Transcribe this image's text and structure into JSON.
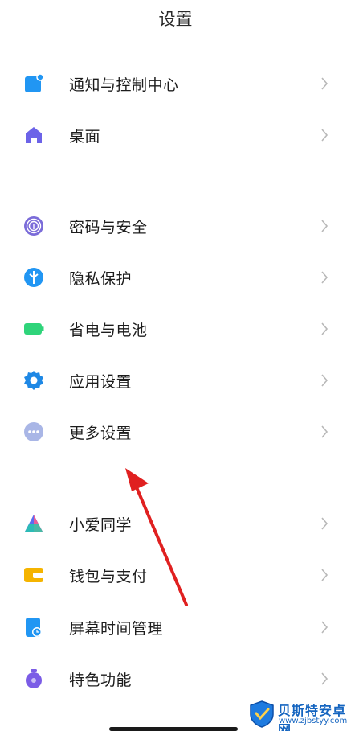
{
  "header": {
    "title": "设置"
  },
  "sections": [
    {
      "items": [
        {
          "label": "通知与控制中心",
          "icon": "notification-icon",
          "color": "#2196f3"
        },
        {
          "label": "桌面",
          "icon": "home-icon",
          "color": "#6c63e8"
        }
      ]
    },
    {
      "items": [
        {
          "label": "密码与安全",
          "icon": "fingerprint-icon",
          "color": "#7b6cd9"
        },
        {
          "label": "隐私保护",
          "icon": "privacy-shield-icon",
          "color": "#2196f3"
        },
        {
          "label": "省电与电池",
          "icon": "battery-icon",
          "color": "#2fd47a"
        },
        {
          "label": "应用设置",
          "icon": "gear-icon",
          "color": "#1e88e5"
        },
        {
          "label": "更多设置",
          "icon": "more-dots-icon",
          "color": "#a9b6e6"
        }
      ]
    },
    {
      "items": [
        {
          "label": "小爱同学",
          "icon": "xiaoai-icon",
          "color": "#5b6cf0"
        },
        {
          "label": "钱包与支付",
          "icon": "wallet-icon",
          "color": "#f5b400"
        },
        {
          "label": "屏幕时间管理",
          "icon": "screen-time-icon",
          "color": "#2196f3"
        },
        {
          "label": "特色功能",
          "icon": "feature-icon",
          "color": "#7b5ce6"
        }
      ]
    }
  ],
  "annotation": {
    "arrow_color": "#e02020"
  },
  "watermark": {
    "title": "贝斯特安卓网",
    "url": "www.zjbstyy.com"
  }
}
